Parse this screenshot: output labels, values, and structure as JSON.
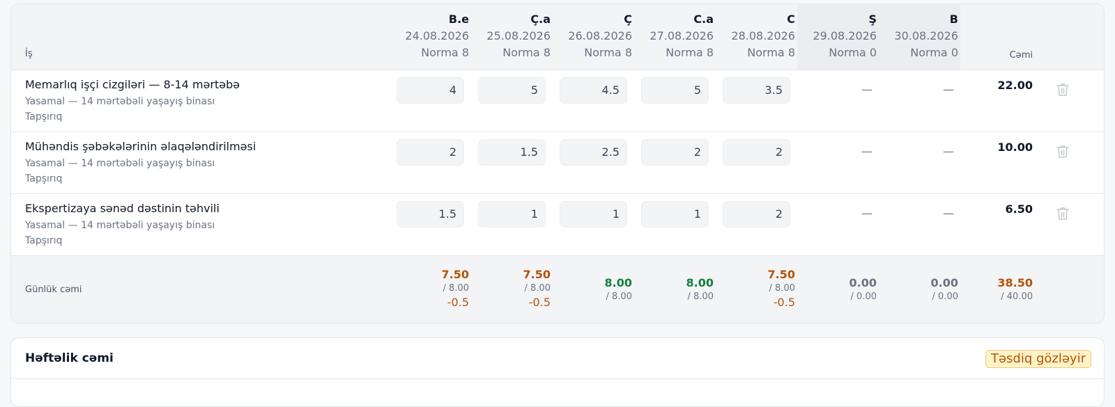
{
  "header": {
    "task_col": "İş",
    "total_col": "Cəmi",
    "days": [
      {
        "name": "B.e",
        "date": "24.08.2026",
        "norm": "Norma 8"
      },
      {
        "name": "Ç.a",
        "date": "25.08.2026",
        "norm": "Norma 8"
      },
      {
        "name": "Ç",
        "date": "26.08.2026",
        "norm": "Norma 8"
      },
      {
        "name": "C.a",
        "date": "27.08.2026",
        "norm": "Norma 8"
      },
      {
        "name": "C",
        "date": "28.08.2026",
        "norm": "Norma 8"
      },
      {
        "name": "Ş",
        "date": "29.08.2026",
        "norm": "Norma 0"
      },
      {
        "name": "B",
        "date": "30.08.2026",
        "norm": "Norma 0"
      }
    ]
  },
  "rows": [
    {
      "title": "Memarlıq işçi cizgiləri — 8-14 mərtəbə",
      "project": "Yasamal — 14 mərtəbəli yaşayış binası",
      "type": "Tapşırıq",
      "hours": [
        "4",
        "5",
        "4.5",
        "5",
        "3.5"
      ],
      "weekend": [
        "—",
        "—"
      ],
      "total": "22.00"
    },
    {
      "title": "Mühəndis şəbəkələrinin əlaqələndirilməsi",
      "project": "Yasamal — 14 mərtəbəli yaşayış binası",
      "type": "Tapşırıq",
      "hours": [
        "2",
        "1.5",
        "2.5",
        "2",
        "2"
      ],
      "weekend": [
        "—",
        "—"
      ],
      "total": "10.00"
    },
    {
      "title": "Ekspertizaya sənəd dəstinin təhvili",
      "project": "Yasamal — 14 mərtəbəli yaşayış binası",
      "type": "Tapşırıq",
      "hours": [
        "1.5",
        "1",
        "1",
        "1",
        "2"
      ],
      "weekend": [
        "—",
        "—"
      ],
      "total": "6.50"
    }
  ],
  "totals": {
    "label": "Günlük cəmi",
    "days": [
      {
        "value": "7.50",
        "norm": "/ 8.00",
        "diff": "-0.5",
        "status": "under"
      },
      {
        "value": "7.50",
        "norm": "/ 8.00",
        "diff": "-0.5",
        "status": "under"
      },
      {
        "value": "8.00",
        "norm": "/ 8.00",
        "diff": "",
        "status": "ok"
      },
      {
        "value": "8.00",
        "norm": "/ 8.00",
        "diff": "",
        "status": "ok"
      },
      {
        "value": "7.50",
        "norm": "/ 8.00",
        "diff": "-0.5",
        "status": "under"
      },
      {
        "value": "0.00",
        "norm": "/ 0.00",
        "diff": "",
        "status": "none"
      },
      {
        "value": "0.00",
        "norm": "/ 0.00",
        "diff": "",
        "status": "none"
      }
    ],
    "week": {
      "value": "38.50",
      "norm": "/ 40.00",
      "status": "under"
    }
  },
  "weekly": {
    "title": "Həftəlik cəmi",
    "status_badge": "Təsdiq gözləyir"
  },
  "colors": {
    "under": "#b45309",
    "ok": "#15803d",
    "none": "#6b7280"
  },
  "icons": {
    "delete": "trash-icon"
  }
}
